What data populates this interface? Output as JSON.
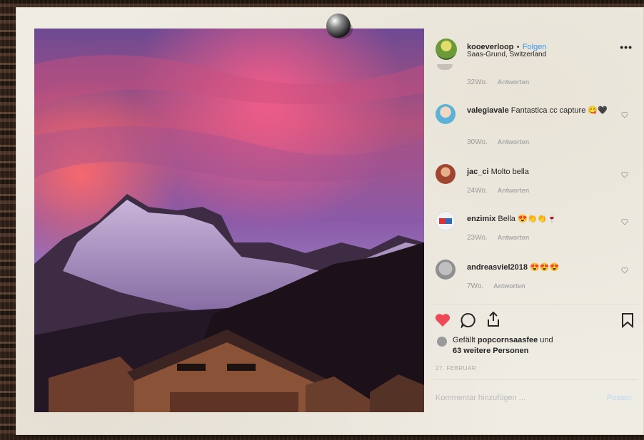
{
  "post": {
    "username": "kooeverloop",
    "separator": "•",
    "follow_label": "Folgen",
    "location": "Saas-Grund, Switzerland",
    "more_label": "•••"
  },
  "comments": [
    {
      "username": "",
      "text": "",
      "age": "32Wo.",
      "reply": "Antworten"
    },
    {
      "username": "valegiavale",
      "text": "Fantastica cc capture 😋🖤",
      "age": "30Wo.",
      "reply": "Antworten"
    },
    {
      "username": "jac_ci",
      "text": "Molto bella",
      "age": "24Wo.",
      "reply": "Antworten"
    },
    {
      "username": "enzimix",
      "text": "Bella 😍👏👏🍷",
      "age": "23Wo.",
      "reply": "Antworten"
    },
    {
      "username": "andreasviel2018",
      "text": "😍😍😍",
      "age": "7Wo.",
      "reply": "Antworten"
    }
  ],
  "likes": {
    "prefix": "Gefällt",
    "user": "popcornsaasfee",
    "conj": "und",
    "others": "63 weitere Personen"
  },
  "date": "27. FEBRUAR",
  "add_comment": {
    "placeholder": "Kommentar hinzufügen ...",
    "post_label": "Posten"
  },
  "colors": {
    "heart": "#ed4956",
    "link": "#3897f0",
    "text": "#262626",
    "sky_top": "#7a4f9a",
    "sky_pink": "#e0557e"
  }
}
